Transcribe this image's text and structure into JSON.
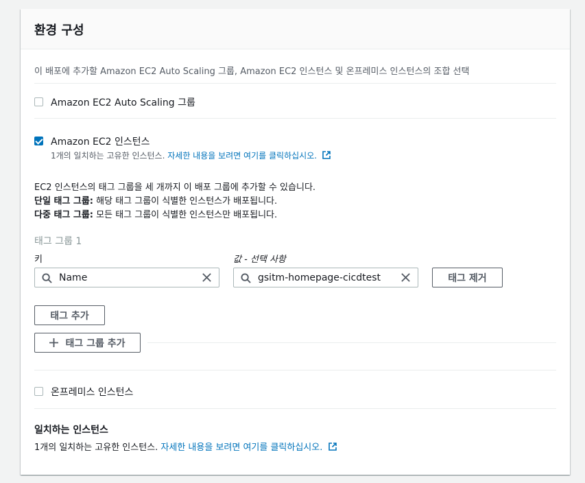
{
  "panel": {
    "title": "환경 구성",
    "description": "이 배포에 추가할 Amazon EC2 Auto Scaling 그룹, Amazon EC2 인스턴스 및 온프레미스 인스턴스의 조합 선택"
  },
  "options": {
    "asg_label": "Amazon EC2 Auto Scaling 그룹",
    "asg_checked": false,
    "ec2_label": "Amazon EC2 인스턴스",
    "ec2_checked": true,
    "ec2_sub_text": "1개의 일치하는 고유한 인스턴스.",
    "ec2_sub_link": "자세한 내용을 보려면 여기를 클릭하십시오.",
    "onprem_label": "온프레미스 인스턴스",
    "onprem_checked": false
  },
  "info": {
    "line1": "EC2 인스턴스의 태그 그룹을 세 개까지 이 배포 그룹에 추가할 수 있습니다.",
    "single_bold": "단일 태그 그룹:",
    "single_text": "해당 태그 그룹이 식별한 인스턴스가 배포됩니다.",
    "multi_bold": "다중 태그 그룹:",
    "multi_text": "모든 태그 그룹이 식별한 인스턴스만 배포됩니다."
  },
  "tag_group": {
    "title": "태그 그룹 1",
    "key_label": "키",
    "value_label": "값 - 선택 사항",
    "key_value": "Name",
    "value_value": "gsitm-homepage-cicdtest",
    "remove_button": "태그 제거",
    "add_tag_button": "태그 추가",
    "add_group_button": "태그 그룹 추가"
  },
  "matching": {
    "title": "일치하는 인스턴스",
    "text": "1개의 일치하는 고유한 인스턴스.",
    "link": "자세한 내용을 보려면 여기를 클릭하십시오."
  },
  "colors": {
    "accent": "#0073bb",
    "border": "#aab7b8",
    "divider": "#eaeded"
  },
  "icons": [
    "search-icon",
    "clear-icon",
    "external-link-icon",
    "plus-icon",
    "checkbox-icon"
  ]
}
